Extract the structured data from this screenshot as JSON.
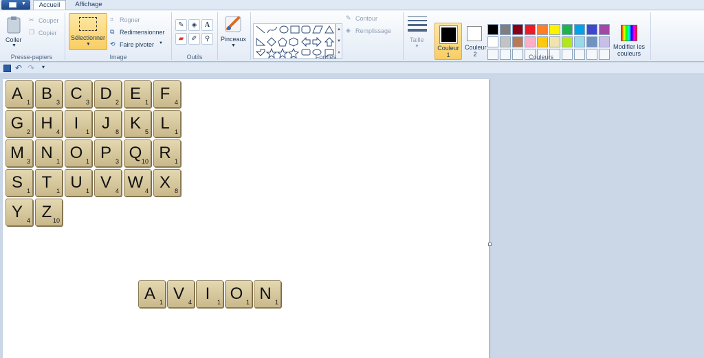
{
  "tabs": {
    "home": "Accueil",
    "view": "Affichage"
  },
  "clipboard": {
    "paste": "Coller",
    "cut": "Couper",
    "copy": "Copier",
    "group": "Presse-papiers"
  },
  "image": {
    "select": "Sélectionner",
    "crop": "Rogner",
    "resize": "Redimensionner",
    "rotate": "Faire pivoter",
    "group": "Image"
  },
  "tools": {
    "group": "Outils"
  },
  "brushes": {
    "label": "Pinceaux"
  },
  "shapes": {
    "outline": "Contour",
    "fill": "Remplissage",
    "group": "Formes"
  },
  "size": {
    "label": "Taille"
  },
  "colors": {
    "color1_label": "Couleur",
    "color1_num": "1",
    "color2_label": "Couleur",
    "color2_num": "2",
    "edit_label1": "Modifier les",
    "edit_label2": "couleurs",
    "group": "Couleurs",
    "color1_value": "#000000",
    "color2_value": "#ffffff",
    "palette_row1": [
      "#000000",
      "#7f7f7f",
      "#880015",
      "#ed1c24",
      "#ff7f27",
      "#fff200",
      "#22b14c",
      "#00a2e8",
      "#3f48cc",
      "#a349a4"
    ],
    "palette_row2": [
      "#ffffff",
      "#c3c3c3",
      "#b97a57",
      "#ffaec9",
      "#ffc90e",
      "#efe4b0",
      "#b5e61d",
      "#99d9ea",
      "#7092be",
      "#c8bfe7"
    ]
  },
  "tiles": [
    {
      "letter": "A",
      "points": "1"
    },
    {
      "letter": "B",
      "points": "3"
    },
    {
      "letter": "C",
      "points": "3"
    },
    {
      "letter": "D",
      "points": "2"
    },
    {
      "letter": "E",
      "points": "1"
    },
    {
      "letter": "F",
      "points": "4"
    },
    {
      "letter": "G",
      "points": "2"
    },
    {
      "letter": "H",
      "points": "4"
    },
    {
      "letter": "I",
      "points": "1"
    },
    {
      "letter": "J",
      "points": "8"
    },
    {
      "letter": "K",
      "points": "5"
    },
    {
      "letter": "L",
      "points": "1"
    },
    {
      "letter": "M",
      "points": "3"
    },
    {
      "letter": "N",
      "points": "1"
    },
    {
      "letter": "O",
      "points": "1"
    },
    {
      "letter": "P",
      "points": "3"
    },
    {
      "letter": "Q",
      "points": "10"
    },
    {
      "letter": "R",
      "points": "1"
    },
    {
      "letter": "S",
      "points": "1"
    },
    {
      "letter": "T",
      "points": "1"
    },
    {
      "letter": "U",
      "points": "1"
    },
    {
      "letter": "V",
      "points": "4"
    },
    {
      "letter": "W",
      "points": "4"
    },
    {
      "letter": "X",
      "points": "8"
    },
    {
      "letter": "Y",
      "points": "4"
    },
    {
      "letter": "Z",
      "points": "10"
    }
  ],
  "word_tiles": [
    {
      "letter": "A",
      "points": "1"
    },
    {
      "letter": "V",
      "points": "4"
    },
    {
      "letter": "I",
      "points": "1"
    },
    {
      "letter": "O",
      "points": "1"
    },
    {
      "letter": "N",
      "points": "1"
    }
  ]
}
